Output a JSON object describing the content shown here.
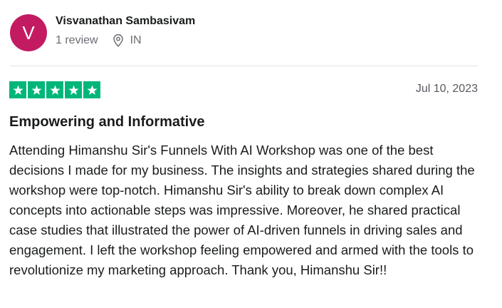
{
  "reviewer": {
    "initial": "V",
    "name": "Visvanathan Sambasivam",
    "review_count": "1 review",
    "country": "IN",
    "avatar_color": "#c31b61"
  },
  "review": {
    "rating": 5,
    "max_rating": 5,
    "star_color": "#00b67a",
    "date": "Jul 10, 2023",
    "title": "Empowering and Informative",
    "body": "Attending Himanshu Sir's Funnels With AI Workshop was one of the best decisions I made for my business. The insights and strategies shared during the workshop were top-notch. Himanshu Sir's ability to break down complex AI concepts into actionable steps was impressive. Moreover, he shared practical case studies that illustrated the power of AI-driven funnels in driving sales and engagement. I left the workshop feeling empowered and armed with the tools to revolutionize my marketing approach. Thank you, Himanshu Sir!!"
  },
  "icons": {
    "location": "location-pin-icon",
    "star": "star-icon"
  }
}
